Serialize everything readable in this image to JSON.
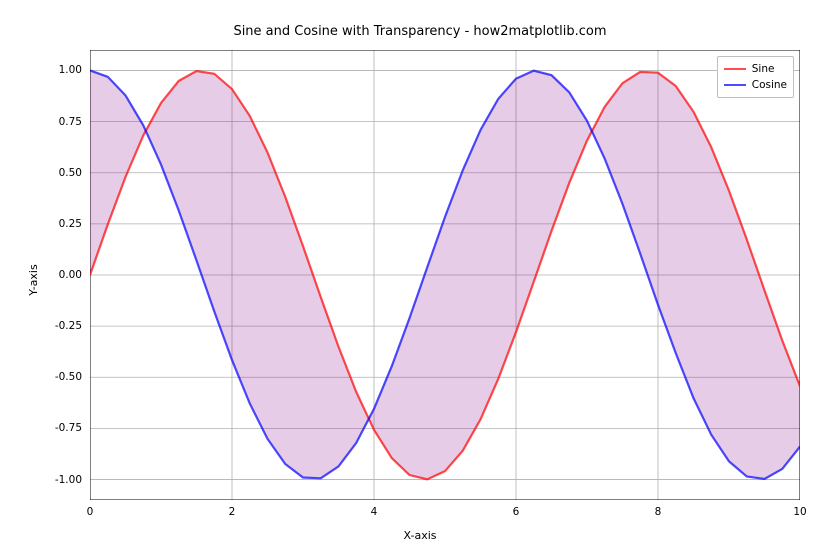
{
  "chart_data": {
    "type": "line",
    "title": "Sine and Cosine with Transparency - how2matplotlib.com",
    "xlabel": "X-axis",
    "ylabel": "Y-axis",
    "xlim": [
      0,
      10
    ],
    "ylim": [
      -1.1,
      1.1
    ],
    "xticks": [
      0,
      2,
      4,
      6,
      8,
      10
    ],
    "yticks": [
      -1.0,
      -0.75,
      -0.5,
      -0.25,
      0.0,
      0.25,
      0.5,
      0.75,
      1.0
    ],
    "grid": true,
    "legend_position": "top-right",
    "fill_between": {
      "series_a": "Sine",
      "series_b": "Cosine",
      "color": "#800080",
      "alpha": 0.2
    },
    "series": [
      {
        "name": "Sine",
        "color": "#ff0000",
        "alpha": 0.7,
        "x": [
          0.0,
          0.25,
          0.5,
          0.75,
          1.0,
          1.25,
          1.5,
          1.75,
          2.0,
          2.25,
          2.5,
          2.75,
          3.0,
          3.25,
          3.5,
          3.75,
          4.0,
          4.25,
          4.5,
          4.75,
          5.0,
          5.25,
          5.5,
          5.75,
          6.0,
          6.25,
          6.5,
          6.75,
          7.0,
          7.25,
          7.5,
          7.75,
          8.0,
          8.25,
          8.5,
          8.75,
          9.0,
          9.25,
          9.5,
          9.75,
          10.0
        ],
        "y": [
          0.0,
          0.247,
          0.479,
          0.682,
          0.841,
          0.949,
          0.997,
          0.984,
          0.909,
          0.778,
          0.599,
          0.382,
          0.141,
          -0.108,
          -0.351,
          -0.572,
          -0.757,
          -0.895,
          -0.978,
          -0.999,
          -0.959,
          -0.859,
          -0.706,
          -0.508,
          -0.279,
          -0.033,
          0.215,
          0.45,
          0.657,
          0.823,
          0.938,
          0.993,
          0.989,
          0.924,
          0.798,
          0.625,
          0.412,
          0.174,
          -0.075,
          -0.32,
          -0.544
        ]
      },
      {
        "name": "Cosine",
        "color": "#0000ff",
        "alpha": 0.7,
        "x": [
          0.0,
          0.25,
          0.5,
          0.75,
          1.0,
          1.25,
          1.5,
          1.75,
          2.0,
          2.25,
          2.5,
          2.75,
          3.0,
          3.25,
          3.5,
          3.75,
          4.0,
          4.25,
          4.5,
          4.75,
          5.0,
          5.25,
          5.5,
          5.75,
          6.0,
          6.25,
          6.5,
          6.75,
          7.0,
          7.25,
          7.5,
          7.75,
          8.0,
          8.25,
          8.5,
          8.75,
          9.0,
          9.25,
          9.5,
          9.75,
          10.0
        ],
        "y": [
          1.0,
          0.969,
          0.878,
          0.732,
          0.54,
          0.315,
          0.071,
          -0.178,
          -0.416,
          -0.628,
          -0.801,
          -0.924,
          -0.99,
          -0.994,
          -0.936,
          -0.821,
          -0.654,
          -0.446,
          -0.211,
          0.038,
          0.284,
          0.512,
          0.709,
          0.861,
          0.96,
          0.999,
          0.977,
          0.893,
          0.754,
          0.568,
          0.347,
          0.104,
          -0.146,
          -0.382,
          -0.602,
          -0.781,
          -0.911,
          -0.985,
          -0.997,
          -0.948,
          -0.839
        ]
      }
    ]
  }
}
